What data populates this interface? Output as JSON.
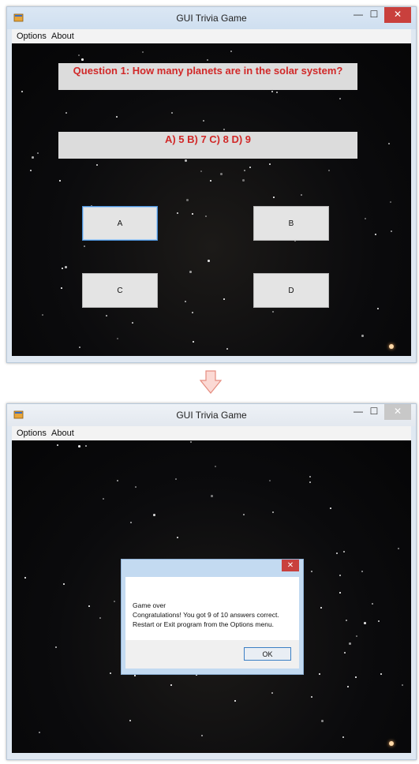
{
  "window": {
    "title": "GUI Trivia Game",
    "minimize_glyph": "—",
    "maximize_glyph": "☐",
    "close_glyph": "✕"
  },
  "menu": {
    "items": [
      "Options",
      "About"
    ]
  },
  "quiz": {
    "question": "Question 1: How many planets are in the solar system?",
    "choices": "A) 5 B) 7 C) 8 D) 9",
    "answer_buttons": [
      "A",
      "B",
      "C",
      "D"
    ]
  },
  "dialog": {
    "close_glyph": "✕",
    "lines": [
      "Game over",
      "Congratulations!  You got 9 of 10 answers correct.",
      "Restart or Exit program from the Options menu."
    ],
    "ok_label": "OK"
  },
  "colors": {
    "question_text": "#d12828",
    "close_button": "#c9403d",
    "focus_border": "#4a8fd6"
  },
  "icons": {
    "app": "app-window-icon",
    "transition": "down-arrow-icon"
  }
}
